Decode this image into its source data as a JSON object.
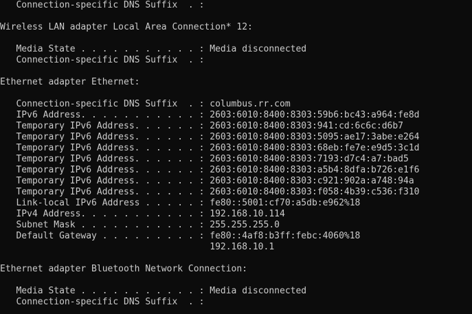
{
  "console": {
    "lines": [
      "   Connection-specific DNS Suffix  . :",
      "",
      "Wireless LAN adapter Local Area Connection* 12:",
      "",
      "   Media State . . . . . . . . . . . : Media disconnected",
      "   Connection-specific DNS Suffix  . :",
      "",
      "Ethernet adapter Ethernet:",
      "",
      "   Connection-specific DNS Suffix  . : columbus.rr.com",
      "   IPv6 Address. . . . . . . . . . . : 2603:6010:8400:8303:59b6:bc43:a964:fe8d",
      "   Temporary IPv6 Address. . . . . . : 2603:6010:8400:8303:941:cd:6c6c:d6b7",
      "   Temporary IPv6 Address. . . . . . : 2603:6010:8400:8303:5095:ae17:3abe:e264",
      "   Temporary IPv6 Address. . . . . . : 2603:6010:8400:8303:68eb:fe7e:e9d5:3c1d",
      "   Temporary IPv6 Address. . . . . . : 2603:6010:8400:8303:7193:d7c4:a7:bad5",
      "   Temporary IPv6 Address. . . . . . : 2603:6010:8400:8303:a5b4:8dfa:b726:e1f6",
      "   Temporary IPv6 Address. . . . . . : 2603:6010:8400:8303:c921:902a:a748:94a",
      "   Temporary IPv6 Address. . . . . . : 2603:6010:8400:8303:f058:4b39:c536:f310",
      "   Link-local IPv6 Address . . . . . : fe80::5001:cf70:a5db:e962%18",
      "   IPv4 Address. . . . . . . . . . . : 192.168.10.114",
      "   Subnet Mask . . . . . . . . . . . : 255.255.255.0",
      "   Default Gateway . . . . . . . . . : fe80::4af8:b3ff:febc:4060%18",
      "                                       192.168.10.1",
      "",
      "Ethernet adapter Bluetooth Network Connection:",
      "",
      "   Media State . . . . . . . . . . . : Media disconnected",
      "   Connection-specific DNS Suffix  . :"
    ]
  }
}
